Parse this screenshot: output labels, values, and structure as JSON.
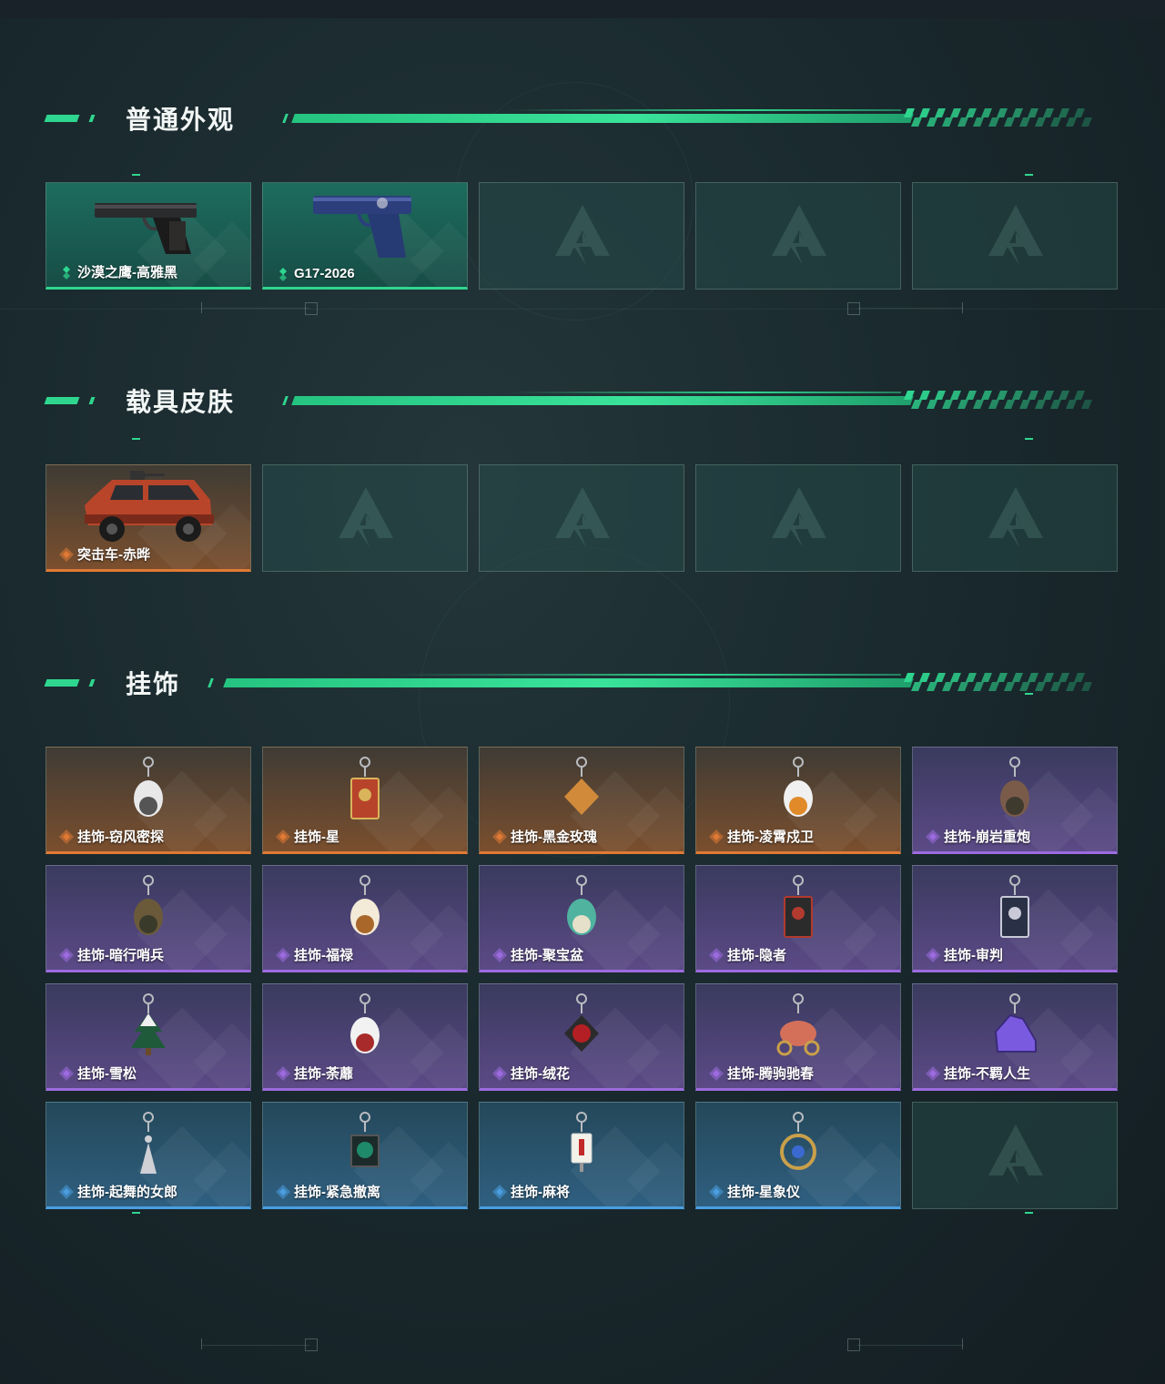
{
  "sections": [
    {
      "title": "普通外观",
      "items": [
        {
          "label": "沙漠之鹰-高雅黑",
          "rarity": "teal",
          "icon": "desert-eagle-pistol-icon"
        },
        {
          "label": "G17-2026",
          "rarity": "teal",
          "icon": "g17-pistol-icon"
        },
        {
          "label": "",
          "rarity": "empty"
        },
        {
          "label": "",
          "rarity": "empty"
        },
        {
          "label": "",
          "rarity": "empty"
        }
      ]
    },
    {
      "title": "载具皮肤",
      "items": [
        {
          "label": "突击车-赤晔",
          "rarity": "orange",
          "icon": "assault-vehicle-icon"
        },
        {
          "label": "",
          "rarity": "empty"
        },
        {
          "label": "",
          "rarity": "empty"
        },
        {
          "label": "",
          "rarity": "empty"
        },
        {
          "label": "",
          "rarity": "empty"
        }
      ]
    },
    {
      "title": "挂饰",
      "items": [
        {
          "label": "挂饰-窃风密探",
          "rarity": "orange",
          "icon": "rabbit-charm-icon"
        },
        {
          "label": "挂饰-星",
          "rarity": "orange",
          "icon": "star-card-charm-icon"
        },
        {
          "label": "挂饰-黑金玫瑰",
          "rarity": "orange",
          "icon": "rose-emblem-charm-icon"
        },
        {
          "label": "挂饰-凌霄戍卫",
          "rarity": "orange",
          "icon": "guardian-charm-icon"
        },
        {
          "label": "挂饰-崩岩重炮",
          "rarity": "purple",
          "icon": "rock-golem-charm-icon"
        },
        {
          "label": "挂饰-暗行哨兵",
          "rarity": "purple",
          "icon": "sentinel-charm-icon"
        },
        {
          "label": "挂饰-福禄",
          "rarity": "purple",
          "icon": "gourd-charm-icon"
        },
        {
          "label": "挂饰-聚宝盆",
          "rarity": "purple",
          "icon": "treasure-bowl-charm-icon"
        },
        {
          "label": "挂饰-隐者",
          "rarity": "purple",
          "icon": "hermit-card-charm-icon"
        },
        {
          "label": "挂饰-审判",
          "rarity": "purple",
          "icon": "judgement-card-charm-icon"
        },
        {
          "label": "挂饰-雪松",
          "rarity": "purple",
          "icon": "snow-pine-charm-icon"
        },
        {
          "label": "挂饰-荼蘼",
          "rarity": "purple",
          "icon": "white-flower-charm-icon"
        },
        {
          "label": "挂饰-绒花",
          "rarity": "purple",
          "icon": "red-flower-charm-icon"
        },
        {
          "label": "挂饰-腾驹驰春",
          "rarity": "purple",
          "icon": "carriage-charm-icon"
        },
        {
          "label": "挂饰-不羁人生",
          "rarity": "purple",
          "icon": "sneaker-charm-icon"
        },
        {
          "label": "挂饰-起舞的女郎",
          "rarity": "blue",
          "icon": "dancer-charm-icon"
        },
        {
          "label": "挂饰-紧急撤离",
          "rarity": "blue",
          "icon": "exit-sign-charm-icon"
        },
        {
          "label": "挂饰-麻将",
          "rarity": "blue",
          "icon": "mahjong-tile-charm-icon"
        },
        {
          "label": "挂饰-星象仪",
          "rarity": "blue",
          "icon": "astrolabe-charm-icon"
        },
        {
          "label": "",
          "rarity": "empty"
        }
      ]
    }
  ],
  "colors": {
    "accent": "#2fd68f",
    "teal": "#2fd68f",
    "orange": "#e07a34",
    "purple": "#9d6be0",
    "blue": "#4b9ee0"
  }
}
